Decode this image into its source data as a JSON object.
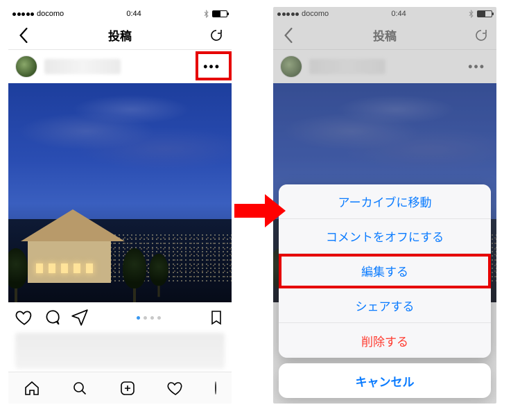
{
  "status": {
    "carrier": "docomo",
    "time": "0:44"
  },
  "nav": {
    "title": "投稿"
  },
  "action_sheet": {
    "options": [
      {
        "label": "アーカイブに移動",
        "destructive": false
      },
      {
        "label": "コメントをオフにする",
        "destructive": false
      },
      {
        "label": "編集する",
        "destructive": false,
        "highlighted": true
      },
      {
        "label": "シェアする",
        "destructive": false
      },
      {
        "label": "削除する",
        "destructive": true
      }
    ],
    "cancel": "キャンセル"
  },
  "pager": {
    "count": 4,
    "active": 0
  }
}
